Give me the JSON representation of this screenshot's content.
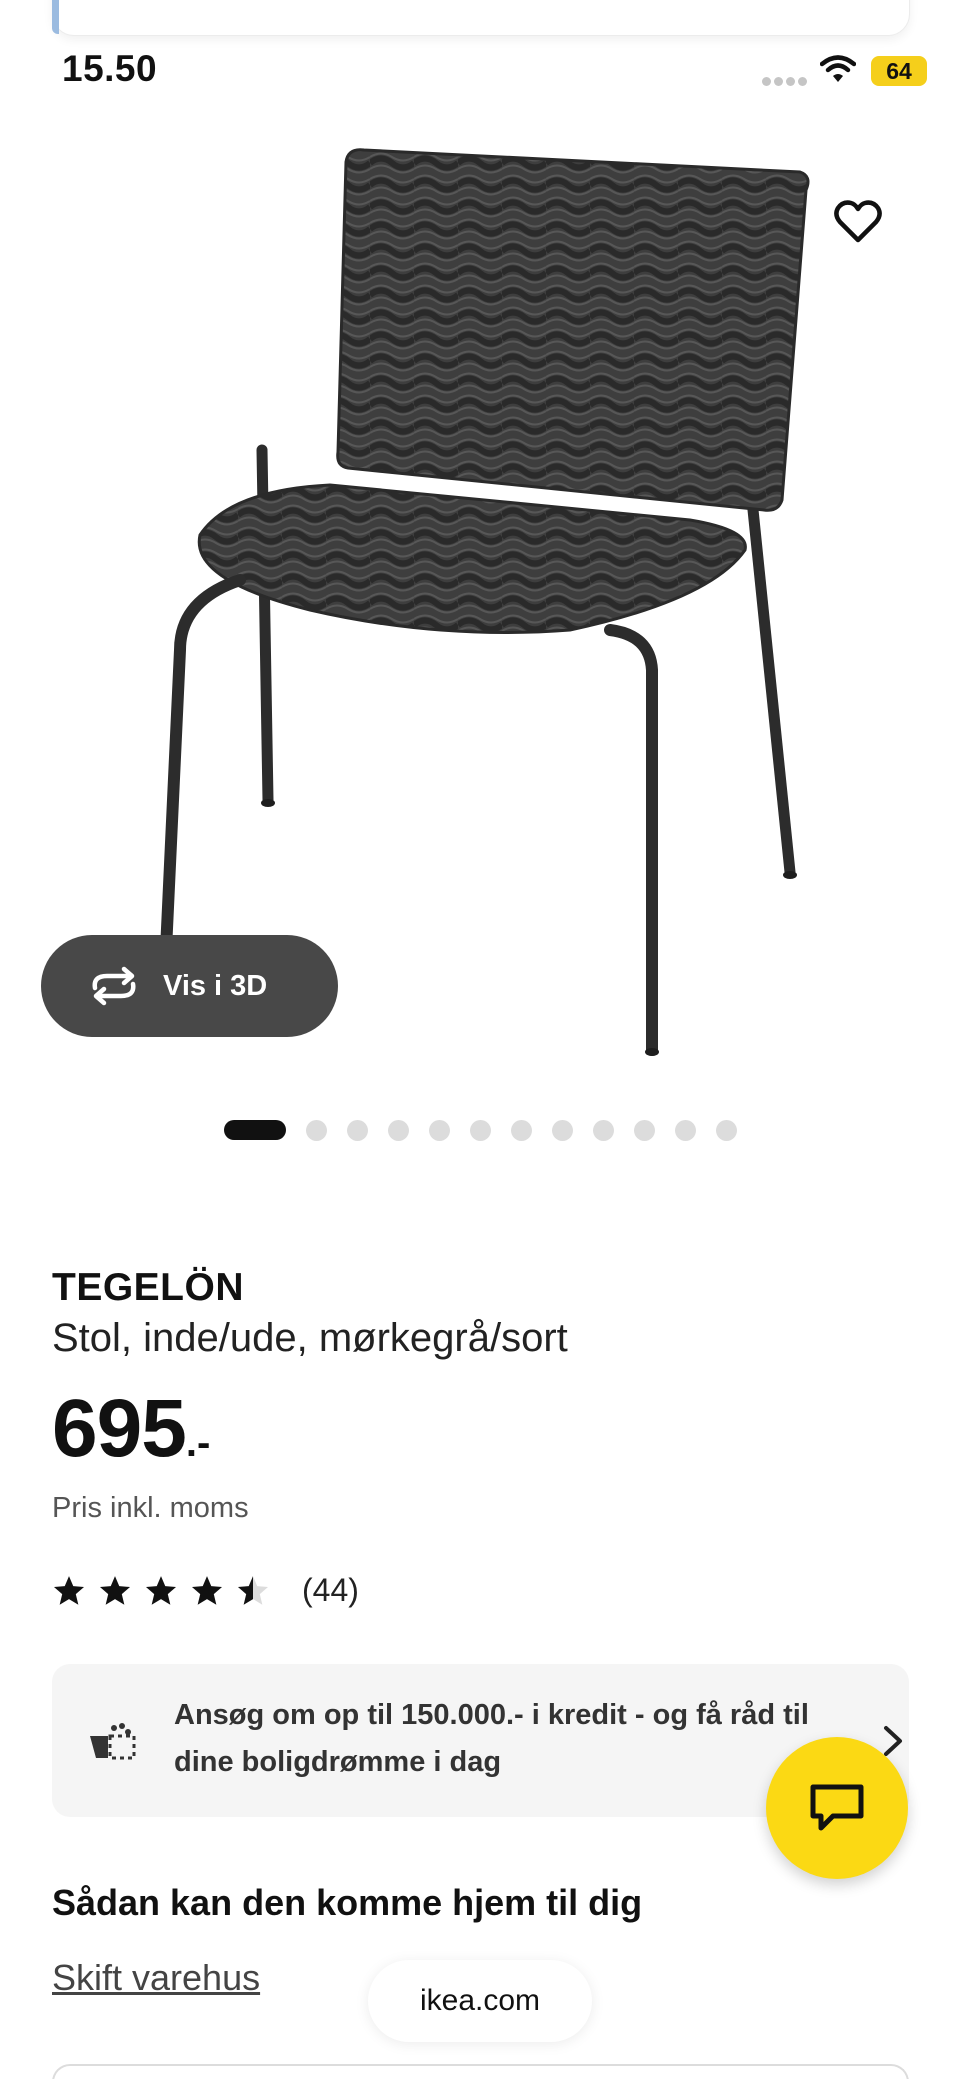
{
  "status_bar": {
    "time": "15.50",
    "battery": "64"
  },
  "product": {
    "name": "TEGELÖN",
    "description": "Stol, inde/ude, mørkegrå/sort",
    "price": "695",
    "price_suffix": ".-",
    "price_note": "Pris inkl. moms",
    "rating_value": 4.5,
    "rating_max": 5,
    "review_count": "(44)"
  },
  "gallery": {
    "view_3d_label": "Vis i 3D",
    "image_count": 12,
    "current_index": 1
  },
  "credit_banner": {
    "text": "Ansøg om op til 150.000.- i kredit - og få råd til dine boligdrømme i dag"
  },
  "delivery": {
    "heading": "Sådan kan den komme hjem til dig",
    "change_store_label": "Skift varehus"
  },
  "browser": {
    "url": "ikea.com"
  },
  "colors": {
    "accent_yellow": "#FBD914",
    "button_dark": "#484848",
    "banner_bg": "#F5F5F5"
  },
  "icons": [
    "wifi-icon",
    "heart-icon",
    "rotate-3d-icon",
    "star-icon",
    "credit-card-icon",
    "chevron-right-icon",
    "chat-icon"
  ]
}
